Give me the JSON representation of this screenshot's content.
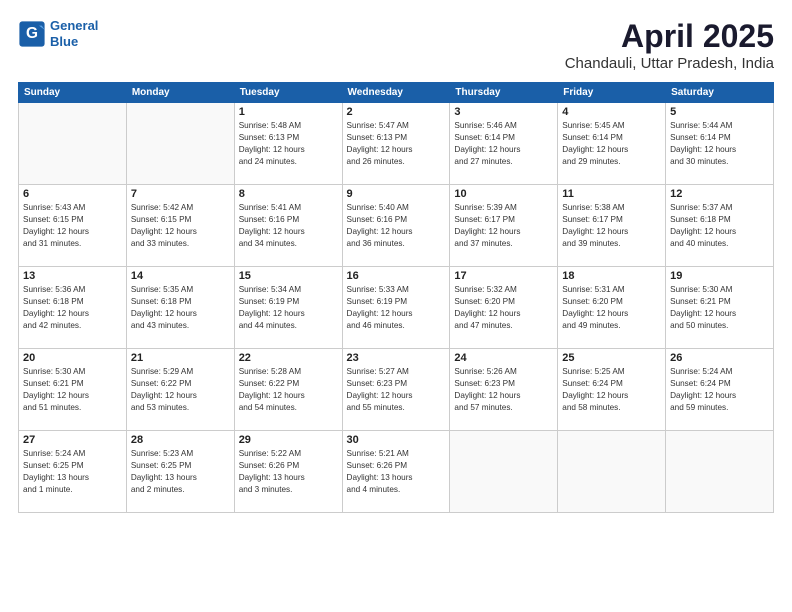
{
  "logo": {
    "line1": "General",
    "line2": "Blue"
  },
  "title": "April 2025",
  "location": "Chandauli, Uttar Pradesh, India",
  "weekdays": [
    "Sunday",
    "Monday",
    "Tuesday",
    "Wednesday",
    "Thursday",
    "Friday",
    "Saturday"
  ],
  "weeks": [
    [
      {
        "day": "",
        "info": ""
      },
      {
        "day": "",
        "info": ""
      },
      {
        "day": "1",
        "info": "Sunrise: 5:48 AM\nSunset: 6:13 PM\nDaylight: 12 hours\nand 24 minutes."
      },
      {
        "day": "2",
        "info": "Sunrise: 5:47 AM\nSunset: 6:13 PM\nDaylight: 12 hours\nand 26 minutes."
      },
      {
        "day": "3",
        "info": "Sunrise: 5:46 AM\nSunset: 6:14 PM\nDaylight: 12 hours\nand 27 minutes."
      },
      {
        "day": "4",
        "info": "Sunrise: 5:45 AM\nSunset: 6:14 PM\nDaylight: 12 hours\nand 29 minutes."
      },
      {
        "day": "5",
        "info": "Sunrise: 5:44 AM\nSunset: 6:14 PM\nDaylight: 12 hours\nand 30 minutes."
      }
    ],
    [
      {
        "day": "6",
        "info": "Sunrise: 5:43 AM\nSunset: 6:15 PM\nDaylight: 12 hours\nand 31 minutes."
      },
      {
        "day": "7",
        "info": "Sunrise: 5:42 AM\nSunset: 6:15 PM\nDaylight: 12 hours\nand 33 minutes."
      },
      {
        "day": "8",
        "info": "Sunrise: 5:41 AM\nSunset: 6:16 PM\nDaylight: 12 hours\nand 34 minutes."
      },
      {
        "day": "9",
        "info": "Sunrise: 5:40 AM\nSunset: 6:16 PM\nDaylight: 12 hours\nand 36 minutes."
      },
      {
        "day": "10",
        "info": "Sunrise: 5:39 AM\nSunset: 6:17 PM\nDaylight: 12 hours\nand 37 minutes."
      },
      {
        "day": "11",
        "info": "Sunrise: 5:38 AM\nSunset: 6:17 PM\nDaylight: 12 hours\nand 39 minutes."
      },
      {
        "day": "12",
        "info": "Sunrise: 5:37 AM\nSunset: 6:18 PM\nDaylight: 12 hours\nand 40 minutes."
      }
    ],
    [
      {
        "day": "13",
        "info": "Sunrise: 5:36 AM\nSunset: 6:18 PM\nDaylight: 12 hours\nand 42 minutes."
      },
      {
        "day": "14",
        "info": "Sunrise: 5:35 AM\nSunset: 6:18 PM\nDaylight: 12 hours\nand 43 minutes."
      },
      {
        "day": "15",
        "info": "Sunrise: 5:34 AM\nSunset: 6:19 PM\nDaylight: 12 hours\nand 44 minutes."
      },
      {
        "day": "16",
        "info": "Sunrise: 5:33 AM\nSunset: 6:19 PM\nDaylight: 12 hours\nand 46 minutes."
      },
      {
        "day": "17",
        "info": "Sunrise: 5:32 AM\nSunset: 6:20 PM\nDaylight: 12 hours\nand 47 minutes."
      },
      {
        "day": "18",
        "info": "Sunrise: 5:31 AM\nSunset: 6:20 PM\nDaylight: 12 hours\nand 49 minutes."
      },
      {
        "day": "19",
        "info": "Sunrise: 5:30 AM\nSunset: 6:21 PM\nDaylight: 12 hours\nand 50 minutes."
      }
    ],
    [
      {
        "day": "20",
        "info": "Sunrise: 5:30 AM\nSunset: 6:21 PM\nDaylight: 12 hours\nand 51 minutes."
      },
      {
        "day": "21",
        "info": "Sunrise: 5:29 AM\nSunset: 6:22 PM\nDaylight: 12 hours\nand 53 minutes."
      },
      {
        "day": "22",
        "info": "Sunrise: 5:28 AM\nSunset: 6:22 PM\nDaylight: 12 hours\nand 54 minutes."
      },
      {
        "day": "23",
        "info": "Sunrise: 5:27 AM\nSunset: 6:23 PM\nDaylight: 12 hours\nand 55 minutes."
      },
      {
        "day": "24",
        "info": "Sunrise: 5:26 AM\nSunset: 6:23 PM\nDaylight: 12 hours\nand 57 minutes."
      },
      {
        "day": "25",
        "info": "Sunrise: 5:25 AM\nSunset: 6:24 PM\nDaylight: 12 hours\nand 58 minutes."
      },
      {
        "day": "26",
        "info": "Sunrise: 5:24 AM\nSunset: 6:24 PM\nDaylight: 12 hours\nand 59 minutes."
      }
    ],
    [
      {
        "day": "27",
        "info": "Sunrise: 5:24 AM\nSunset: 6:25 PM\nDaylight: 13 hours\nand 1 minute."
      },
      {
        "day": "28",
        "info": "Sunrise: 5:23 AM\nSunset: 6:25 PM\nDaylight: 13 hours\nand 2 minutes."
      },
      {
        "day": "29",
        "info": "Sunrise: 5:22 AM\nSunset: 6:26 PM\nDaylight: 13 hours\nand 3 minutes."
      },
      {
        "day": "30",
        "info": "Sunrise: 5:21 AM\nSunset: 6:26 PM\nDaylight: 13 hours\nand 4 minutes."
      },
      {
        "day": "",
        "info": ""
      },
      {
        "day": "",
        "info": ""
      },
      {
        "day": "",
        "info": ""
      }
    ]
  ]
}
